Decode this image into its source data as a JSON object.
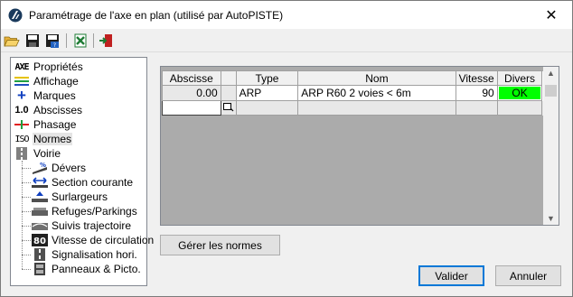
{
  "window": {
    "title": "Paramétrage de l'axe en plan (utilisé par AutoPISTE)",
    "close_glyph": "✕"
  },
  "toolbar": {
    "buttons": [
      {
        "name": "open-folder-icon"
      },
      {
        "name": "save-icon"
      },
      {
        "name": "save-as-icon"
      },
      {
        "name": "excel-icon"
      },
      {
        "name": "exit-icon"
      }
    ]
  },
  "tree": {
    "items": [
      {
        "icon_text": "AXE",
        "label": "Propriétés",
        "icon": "axe-icon"
      },
      {
        "icon_text": "",
        "label": "Affichage",
        "icon": "display-icon"
      },
      {
        "icon_text": "+",
        "label": "Marques",
        "icon": "marks-plus-icon"
      },
      {
        "icon_text": "1.0",
        "label": "Abscisses",
        "icon": "abscissa-icon"
      },
      {
        "icon_text": "",
        "label": "Phasage",
        "icon": "phasing-icon"
      },
      {
        "icon_text": "ISO",
        "label": "Normes",
        "icon": "iso-norms-icon",
        "selected": true
      },
      {
        "icon_text": "",
        "label": "Voirie",
        "icon": "road-icon"
      }
    ],
    "children": [
      {
        "icon_text": "%",
        "label": "Dévers",
        "icon": "cant-icon"
      },
      {
        "icon_text": "↔",
        "label": "Section courante",
        "icon": "section-icon"
      },
      {
        "icon_text": "",
        "label": "Surlargeurs",
        "icon": "widening-icon"
      },
      {
        "icon_text": "",
        "label": "Refuges/Parkings",
        "icon": "parking-icon"
      },
      {
        "icon_text": "",
        "label": "Suivis trajectoire",
        "icon": "trajectory-icon"
      },
      {
        "icon_text": "80",
        "label": "Vitesse de circulation",
        "icon": "speed-icon"
      },
      {
        "icon_text": "",
        "label": "Signalisation hori.",
        "icon": "marking-icon"
      },
      {
        "icon_text": "",
        "label": "Panneaux & Picto.",
        "icon": "signs-icon"
      }
    ]
  },
  "grid": {
    "columns": [
      "Abscisse",
      "",
      "Type",
      "Nom",
      "Vitesse",
      "Divers"
    ],
    "rows": [
      {
        "abscisse": "0.00",
        "type": "ARP",
        "nom": "ARP R60 2 voies < 6m",
        "vitesse": "90",
        "divers": "OK"
      }
    ],
    "ok_color": "#00ff00"
  },
  "buttons": {
    "manage_norms": "Gérer les normes",
    "validate": "Valider",
    "cancel": "Annuler"
  }
}
